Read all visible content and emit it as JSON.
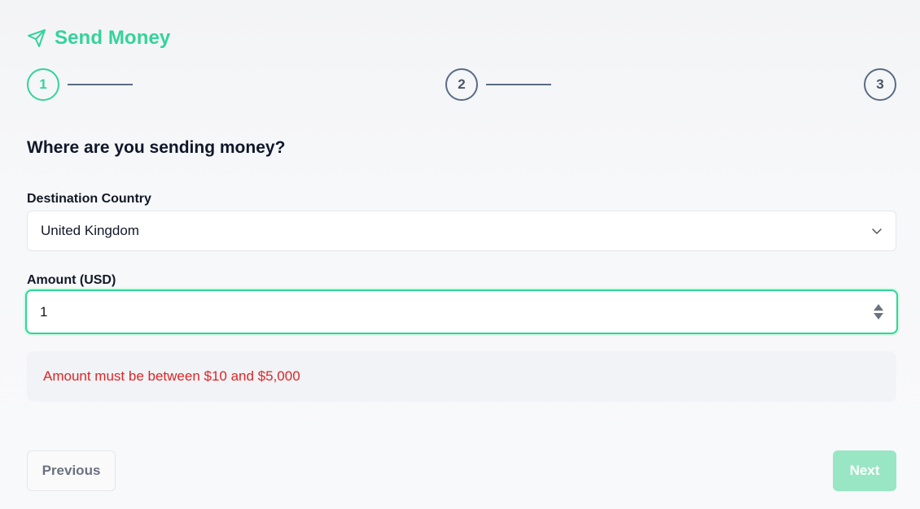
{
  "header": {
    "title": "Send Money",
    "icon": "send-icon"
  },
  "stepper": {
    "steps": [
      {
        "label": "1",
        "state": "active"
      },
      {
        "label": "2",
        "state": "inactive"
      },
      {
        "label": "3",
        "state": "inactive"
      }
    ]
  },
  "form": {
    "question": "Where are you sending money?",
    "country_label": "Destination Country",
    "country_value": "United Kingdom",
    "amount_label": "Amount (USD)",
    "amount_value": "1",
    "error": "Amount must be between $10 and $5,000"
  },
  "actions": {
    "previous": "Previous",
    "next": "Next"
  },
  "colors": {
    "accent": "#34d399",
    "error": "#dc2626",
    "next_disabled": "#99e6c4",
    "step_inactive": "#5b6b84"
  }
}
